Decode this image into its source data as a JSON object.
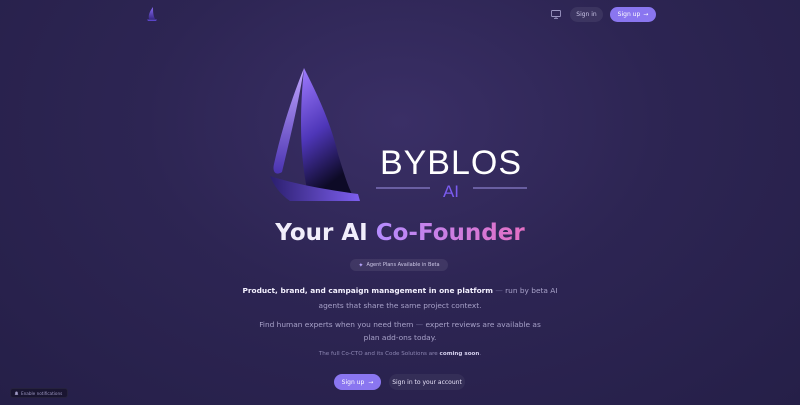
{
  "header": {
    "logo_icon": "sail-logo-icon",
    "monitor_icon": "monitor-icon",
    "signin_label": "Sign in",
    "signup_label": "Sign up",
    "signup_arrow": "→"
  },
  "hero": {
    "brand_name": "BYBLOS",
    "brand_sub": "AI",
    "title_main": "Your AI ",
    "title_accent": "Co-Founder",
    "badge_icon": "sparkle-icon",
    "badge_label": "Agent Plans Available in Beta",
    "p1_bold": "Product, brand, and campaign management in one platform",
    "p1_dash": " — ",
    "p1_rest": "run by beta AI agents that share the same project context.",
    "p2_start": "Find human experts when you need them",
    "p2_dash": " — ",
    "p2_rest": "expert reviews are available as plan add-ons today.",
    "p3_start": "The full Co-CTO and its Code Solutions are ",
    "p3_bold": "coming soon",
    "p3_end": "."
  },
  "cta": {
    "signup_label": "Sign up",
    "signup_arrow": "→",
    "signin_label": "Sign in to your account"
  },
  "toast": {
    "label": "Enable notifications"
  },
  "colors": {
    "accent": "#8a76f0",
    "gradient_start": "#b58cff",
    "gradient_end": "#e36fc4",
    "background": "#2d2553"
  }
}
